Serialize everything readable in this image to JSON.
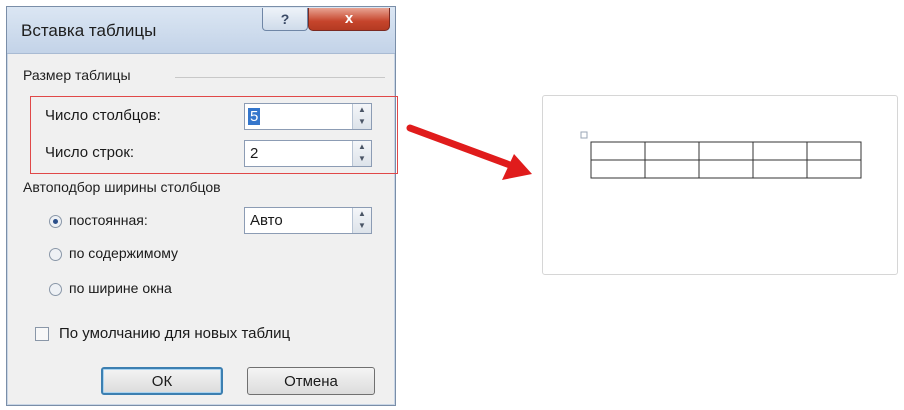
{
  "dialog": {
    "title": "Вставка таблицы",
    "help_label": "?",
    "close_label": "x",
    "size_group": {
      "label": "Размер таблицы",
      "columns_label": "Число столбцов:",
      "columns_value": "5",
      "rows_label": "Число строк:",
      "rows_value": "2"
    },
    "autofit_group": {
      "label": "Автоподбор ширины столбцов",
      "options": [
        {
          "label": "постоянная:",
          "selected": true
        },
        {
          "label": "по содержимому",
          "selected": false
        },
        {
          "label": "по ширине окна",
          "selected": false
        }
      ],
      "fixed_width_value": "Авто"
    },
    "default_checkbox": {
      "label": "По умолчанию для новых таблиц",
      "checked": false
    },
    "ok_label": "ОК",
    "cancel_label": "Отмена"
  },
  "arrow": {
    "color": "#e01c1c"
  },
  "preview_table": {
    "columns": 5,
    "rows": 2
  }
}
